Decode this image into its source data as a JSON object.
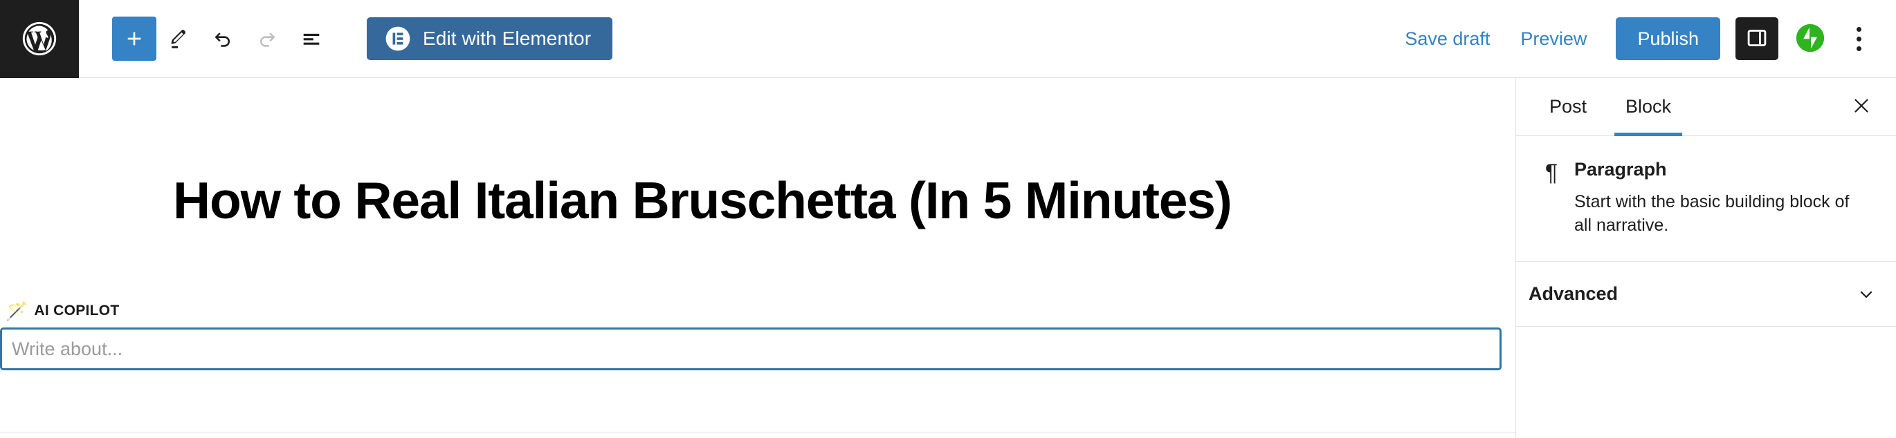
{
  "toolbar": {
    "logo_name": "wordpress-logo",
    "add_block_label": "+",
    "tools_label": "Tools",
    "undo_label": "Undo",
    "redo_label": "Redo",
    "list_view_label": "Document Overview",
    "elementor_button_label": "Edit with Elementor",
    "save_draft_label": "Save draft",
    "preview_label": "Preview",
    "publish_label": "Publish",
    "settings_toggle_label": "Settings",
    "jetpack_label": "Jetpack",
    "options_label": "Options"
  },
  "editor": {
    "post_title": "How to Real Italian Bruschetta (In 5 Minutes)",
    "copilot": {
      "icon": "magic-wand-icon",
      "label": "AI COPILOT",
      "input_value": "",
      "input_placeholder": "Write about..."
    }
  },
  "sidebar": {
    "tabs": [
      {
        "label": "Post",
        "active": false
      },
      {
        "label": "Block",
        "active": true
      }
    ],
    "close_label": "Close settings",
    "block": {
      "icon": "paragraph-icon",
      "title": "Paragraph",
      "description": "Start with the basic building block of all narrative."
    },
    "panels": [
      {
        "label": "Advanced",
        "expanded": false
      }
    ]
  },
  "colors": {
    "accent_blue": "#3582c4",
    "elementor_blue": "#35699c",
    "input_border": "#3174ab",
    "dark": "#1e1e1e",
    "jetpack_green": "#2fb41f",
    "border": "#e0e0e0"
  }
}
